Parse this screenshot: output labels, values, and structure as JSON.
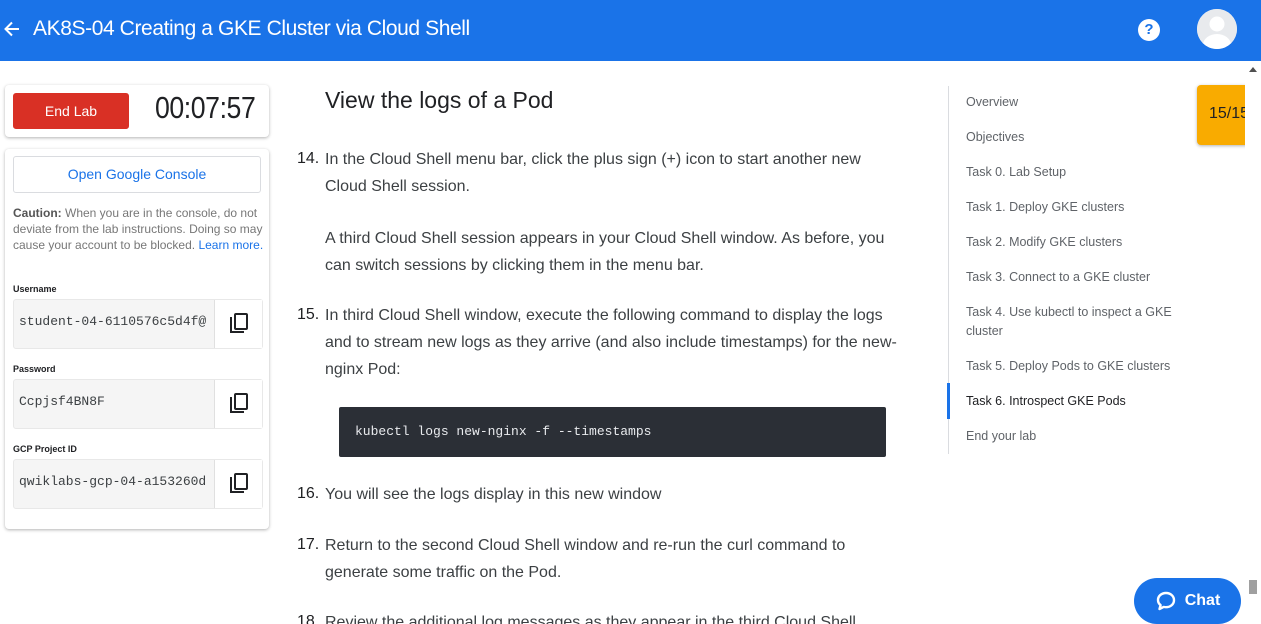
{
  "header": {
    "title": "AK8S-04 Creating a GKE Cluster via Cloud Shell",
    "back_icon": "arrow-left-icon",
    "help_icon": "help-icon",
    "help_glyph": "?",
    "color": "#1a73e8"
  },
  "lab_panel": {
    "end_lab_label": "End Lab",
    "timer": "00:07:57",
    "console_button": "Open Google Console",
    "caution_bold": "Caution:",
    "caution_text": " When you are in the console, do not deviate from the lab instructions. Doing so may cause your account to be blocked. ",
    "learn_more": "Learn more.",
    "fields": [
      {
        "label": "Username",
        "value": "student-04-6110576c5d4f@"
      },
      {
        "label": "Password",
        "value": "Ccpjsf4BN8F"
      },
      {
        "label": "GCP Project ID",
        "value": "qwiklabs-gcp-04-a153260d"
      }
    ]
  },
  "content": {
    "section_title": "View the logs of a Pod",
    "steps": [
      {
        "num": "14.",
        "text": "In the Cloud Shell menu bar, click the plus sign (+) icon to start another new Cloud Shell session."
      },
      {
        "text": "A third Cloud Shell session appears in your Cloud Shell window. As before, you can switch sessions by clicking them in the menu bar."
      },
      {
        "num": "15.",
        "text": "In third Cloud Shell window, execute the following command to display the logs and to stream new logs as they arrive (and also include timestamps) for the new-nginx Pod:"
      },
      {
        "num": "16.",
        "text": "You will see the logs display in this new window"
      },
      {
        "num": "17.",
        "text": "Return to the second Cloud Shell window and re-run the curl command to generate some traffic on the Pod."
      },
      {
        "num": "18.",
        "text": "Review the additional log messages as they appear in the third Cloud Shell"
      }
    ],
    "code": "kubectl logs new-nginx -f --timestamps"
  },
  "toc": {
    "items": [
      "Overview",
      "Objectives",
      "Task 0. Lab Setup",
      "Task 1. Deploy GKE clusters",
      "Task 2. Modify GKE clusters",
      "Task 3. Connect to a GKE cluster",
      "Task 4. Use kubectl to inspect a GKE cluster",
      "Task 5. Deploy Pods to GKE clusters",
      "Task 6. Introspect GKE Pods",
      "End your lab"
    ],
    "active_index": 8
  },
  "progress": "15/15",
  "chat_label": "Chat"
}
